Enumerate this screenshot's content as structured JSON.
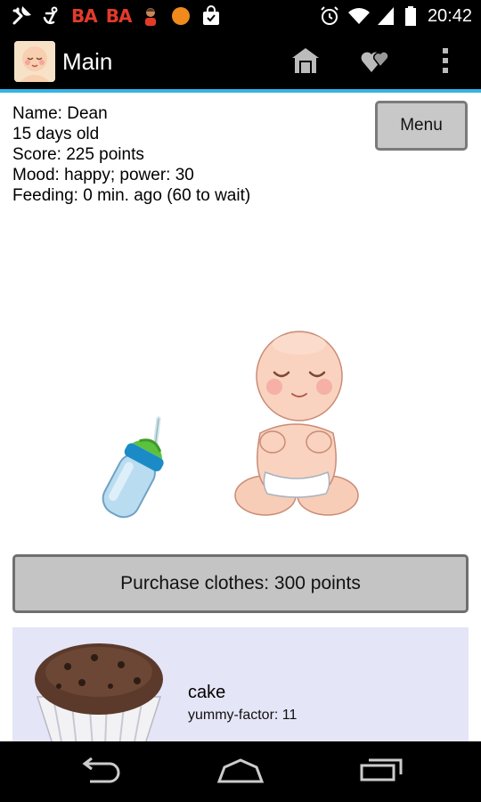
{
  "status_bar": {
    "time": "20:42",
    "ba_1": "BA",
    "ba_2": "BA"
  },
  "action_bar": {
    "title": "Main",
    "icons": [
      "home-icon",
      "hearts-icon",
      "overflow-menu-icon"
    ]
  },
  "info": {
    "name": "Name: Dean",
    "age": "15 days old",
    "score": "Score: 225 points",
    "mood": "Mood: happy; power: 30",
    "feeding": "Feeding: 0 min. ago (60 to wait)"
  },
  "menu_label": "Menu",
  "purchase_label": "Purchase clothes: 300 points",
  "food_item": {
    "name": "cake",
    "subtitle": "yummy-factor: 11"
  },
  "colors": {
    "accent": "#33b5e5",
    "food_panel": "#e5e5f8",
    "button_gray": "#c4c4c4"
  }
}
